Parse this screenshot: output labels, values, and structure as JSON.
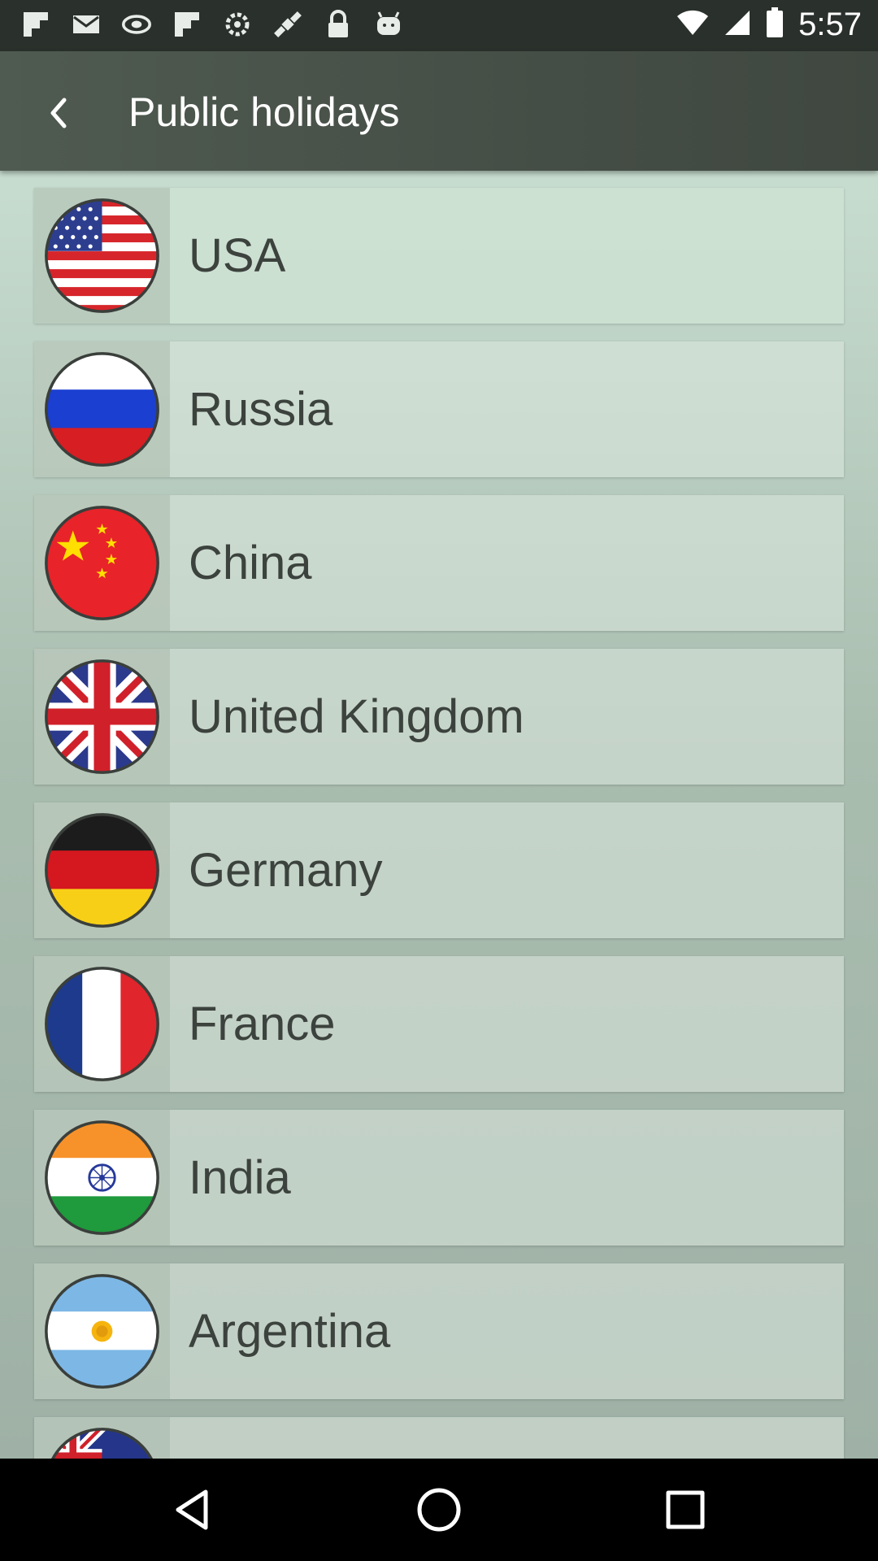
{
  "status_bar": {
    "time": "5:57",
    "icons": [
      "flipboard-icon",
      "mail-icon",
      "radar-icon",
      "flipboard-icon",
      "settings-icon",
      "fake-gps-icon",
      "lock-icon",
      "android-icon"
    ]
  },
  "app_bar": {
    "title": "Public holidays",
    "back_icon": "chevron-left-icon"
  },
  "countries": [
    {
      "name": "USA",
      "flag": "usa-flag-icon"
    },
    {
      "name": "Russia",
      "flag": "russia-flag-icon"
    },
    {
      "name": "China",
      "flag": "china-flag-icon"
    },
    {
      "name": "United Kingdom",
      "flag": "uk-flag-icon"
    },
    {
      "name": "Germany",
      "flag": "germany-flag-icon"
    },
    {
      "name": "France",
      "flag": "france-flag-icon"
    },
    {
      "name": "India",
      "flag": "india-flag-icon"
    },
    {
      "name": "Argentina",
      "flag": "argentina-flag-icon"
    },
    {
      "name": "",
      "flag": "australia-flag-icon"
    }
  ],
  "colors": {
    "app_bar": "#4f5a50",
    "list_bg_top": "#c7ddcf",
    "list_bg_bottom": "#9fb1a6",
    "label_text": "#3c423d"
  },
  "nav_bar": {
    "back": "back-triangle-icon",
    "home": "home-circle-icon",
    "recents": "recents-square-icon"
  }
}
